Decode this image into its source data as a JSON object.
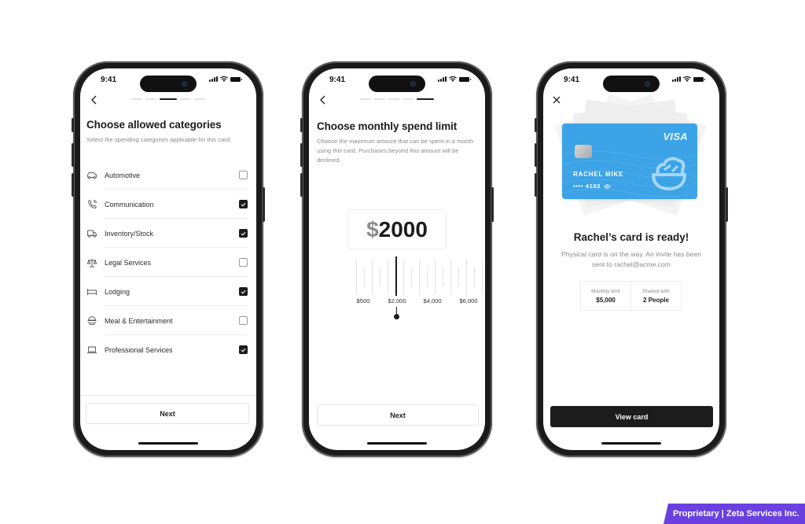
{
  "status_bar": {
    "time": "9:41"
  },
  "screens": {
    "categories": {
      "progress_steps": 5,
      "progress_active": 3,
      "title": "Choose allowed categories",
      "subtitle": "Select the spending categories applicable for this card.",
      "items": [
        {
          "label": "Automotive",
          "icon": "car-icon",
          "checked": false
        },
        {
          "label": "Communication",
          "icon": "phone-icon",
          "checked": true
        },
        {
          "label": "Inventory/Stock",
          "icon": "truck-icon",
          "checked": true
        },
        {
          "label": "Legal Services",
          "icon": "scales-icon",
          "checked": false
        },
        {
          "label": "Lodging",
          "icon": "bed-icon",
          "checked": true
        },
        {
          "label": "Meal & Entertainment",
          "icon": "meal-icon",
          "checked": false
        },
        {
          "label": "Professional Services",
          "icon": "laptop-icon",
          "checked": true
        }
      ],
      "next_label": "Next"
    },
    "spend_limit": {
      "progress_steps": 5,
      "progress_active": 5,
      "title": "Choose monthly spend limit",
      "subtitle": "Choose the maximum amount that can be spent in a month using this card. Purchases beyond this amount will be declined.",
      "currency_symbol": "$",
      "amount": "2000",
      "slider": {
        "value": 2000,
        "labels": [
          "$500",
          "$2,000",
          "$4,000",
          "$6,000"
        ]
      },
      "next_label": "Next"
    },
    "card_ready": {
      "card": {
        "brand": "VISA",
        "holder": "RACHEL MIKE",
        "masked_number": "•••• 4192",
        "color": "#3ca3e6"
      },
      "title": "Rachel’s card is ready!",
      "subtitle": "Physical card is on the way. An invite has been sent to rachel@acme.com",
      "stats": [
        {
          "label": "Monthly limit",
          "value": "$5,000"
        },
        {
          "label": "Shared with",
          "value": "2 People"
        }
      ],
      "view_card_label": "View card"
    }
  },
  "footer_badge": "Proprietary | Zeta Services Inc.",
  "colors": {
    "accent_dark": "#1c1c1c",
    "badge": "#6a40e0",
    "card_blue": "#3ca3e6"
  }
}
